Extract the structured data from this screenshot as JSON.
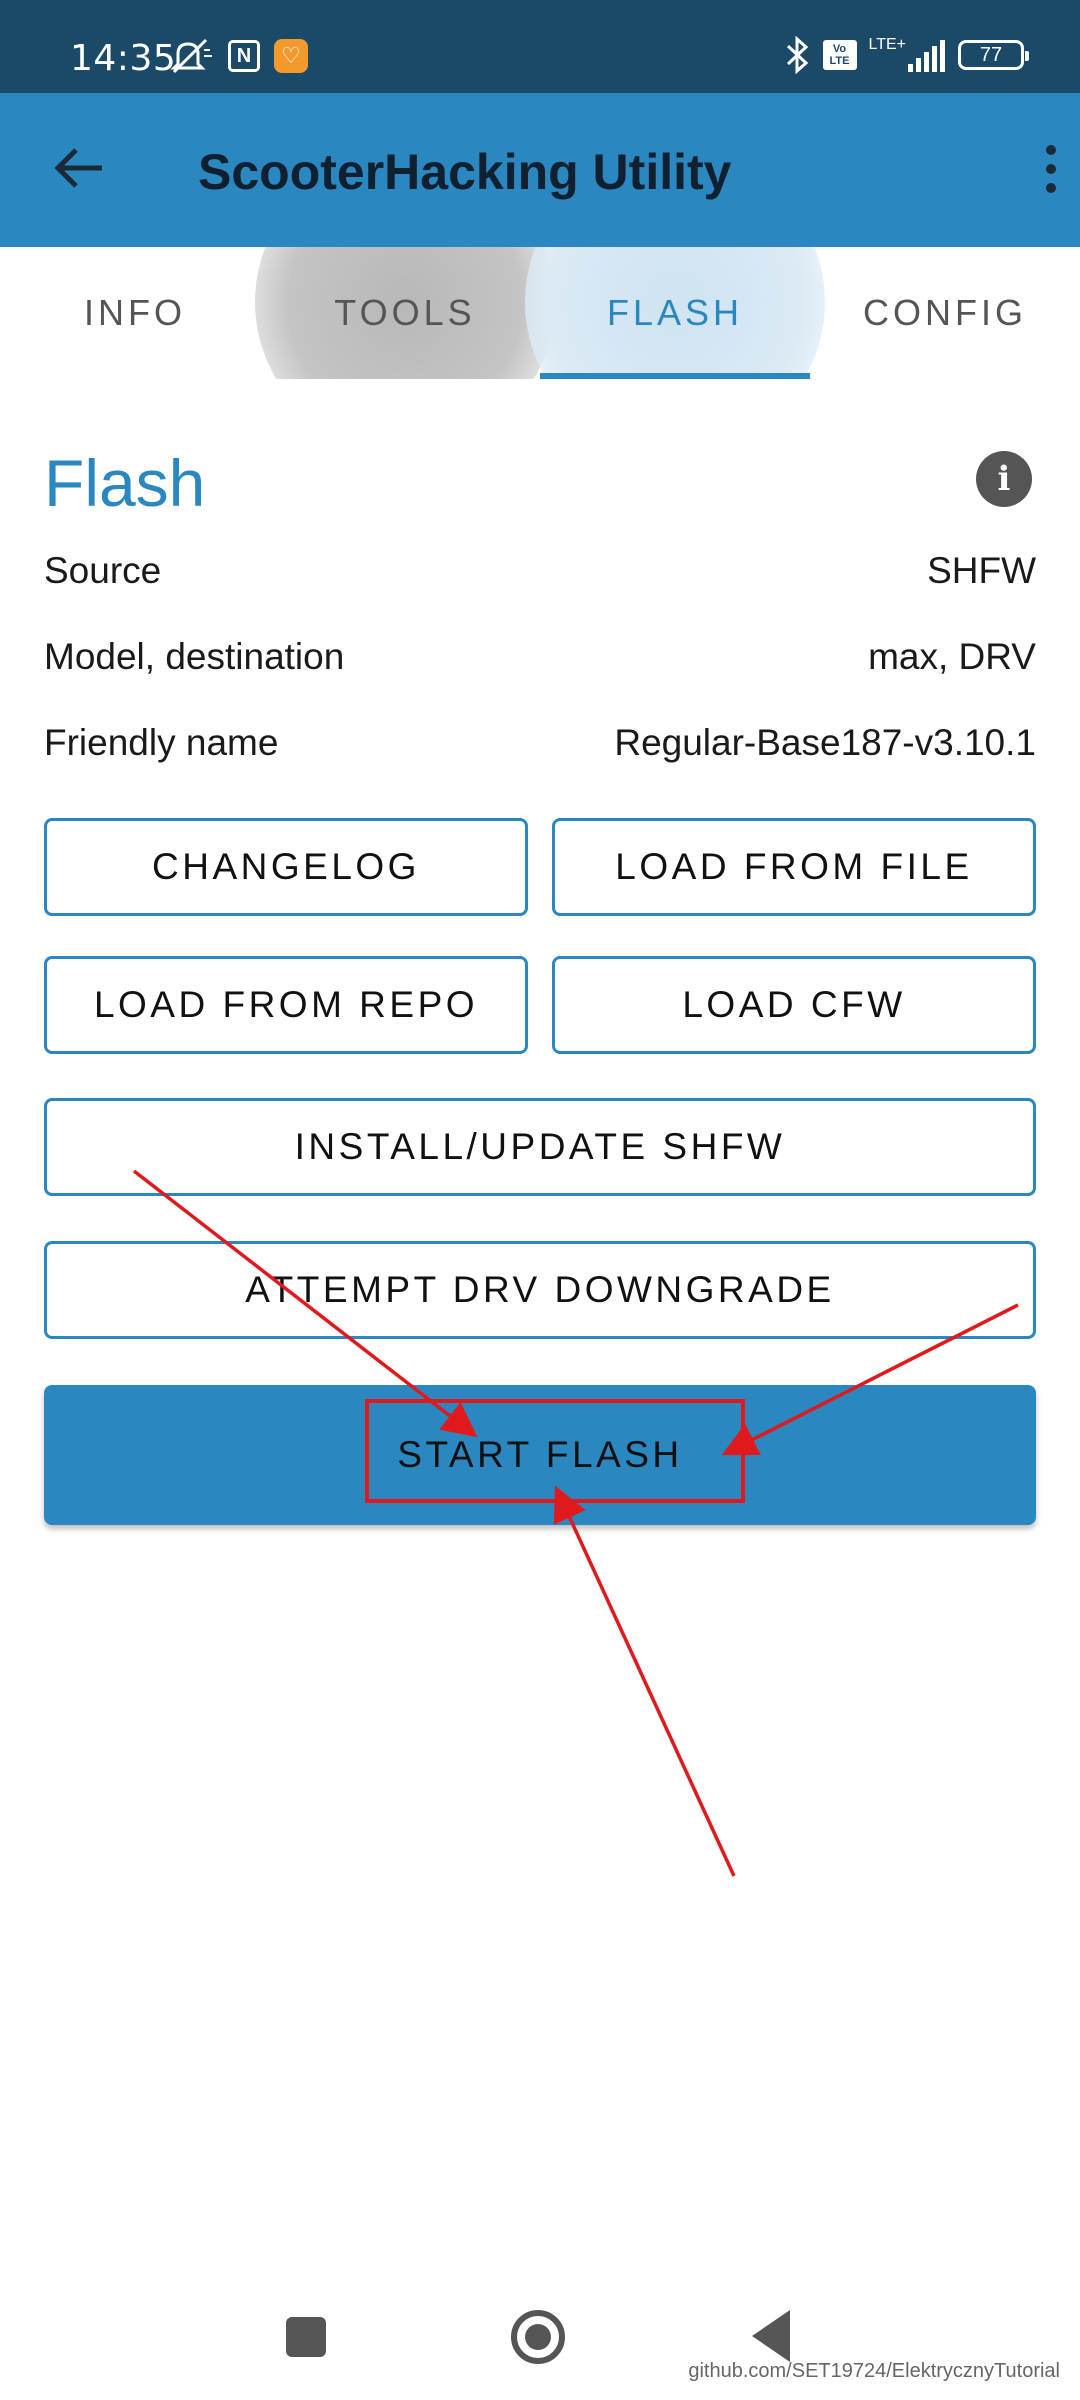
{
  "status_bar": {
    "time": "14:35",
    "lte_label": "LTE+",
    "volte_label": "Vo LTE",
    "battery": "77",
    "icons": [
      "mute-icon",
      "nfc-icon",
      "app-badge-icon",
      "bluetooth-icon",
      "volte-icon",
      "signal-icon",
      "battery-icon"
    ]
  },
  "app_bar": {
    "title": "ScooterHacking Utility",
    "back_icon": "arrow-left-icon",
    "menu_icon": "more-vert-icon"
  },
  "tabs": [
    {
      "label": "INFO",
      "active": false
    },
    {
      "label": "TOOLS",
      "active": false
    },
    {
      "label": "FLASH",
      "active": true
    },
    {
      "label": "CONFIG",
      "active": false
    }
  ],
  "flash": {
    "title": "Flash",
    "info_icon": "info-icon",
    "rows": [
      {
        "label": "Source",
        "value": "SHFW"
      },
      {
        "label": "Model, destination",
        "value": "max, DRV"
      },
      {
        "label": "Friendly name",
        "value": "Regular-Base187-v3.10.1"
      }
    ],
    "buttons": {
      "changelog": "CHANGELOG",
      "load_file": "LOAD FROM FILE",
      "load_repo": "LOAD FROM REPO",
      "load_cfw": "LOAD CFW",
      "install": "INSTALL/UPDATE SHFW",
      "downgrade": "ATTEMPT DRV DOWNGRADE",
      "start": "START FLASH"
    }
  },
  "watermark": "github.com/SET19724/ElektrycznyTutorial",
  "colors": {
    "status_bar": "#1a4a68",
    "app_bar": "#2b87c0",
    "accent": "#2b87c0",
    "annotation": "#e0191c"
  }
}
